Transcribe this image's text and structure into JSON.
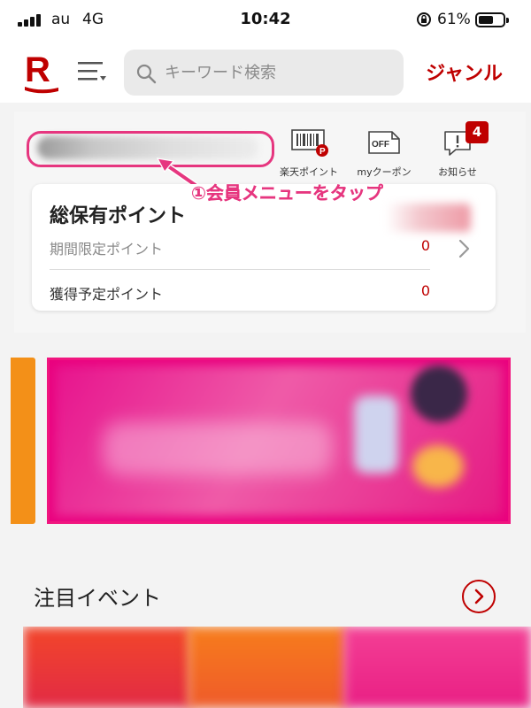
{
  "status_bar": {
    "carrier": "au",
    "network": "4G",
    "time": "10:42",
    "battery_percent": "61%",
    "battery_level": 0.61
  },
  "header": {
    "logo": "R",
    "menu_icon": "menu-icon",
    "search_icon": "search-icon",
    "search_placeholder": "キーワード検索",
    "search_value": "",
    "genre_label": "ジャンル"
  },
  "quick_icons": [
    {
      "label": "楽天ポイント",
      "icon": "rakuten-point-card-icon"
    },
    {
      "label": "myクーポン",
      "icon": "coupon-icon",
      "icon_text": "OFF"
    },
    {
      "label": "お知らせ",
      "icon": "notification-icon",
      "badge": "4"
    }
  ],
  "annotation": {
    "text": "①会員メニューをタップ",
    "color": "#e6367f"
  },
  "points_card": {
    "title": "総保有ポイント",
    "rows": [
      {
        "label": "期間限定ポイント",
        "value": "0"
      },
      {
        "label": "獲得予定ポイント",
        "value": "0"
      }
    ]
  },
  "events": {
    "title": "注目イベント"
  },
  "colors": {
    "brand_red": "#bf0000",
    "highlight_pink": "#e6367f",
    "banner_pink": "#ea007e",
    "banner_orange": "#f39018"
  }
}
